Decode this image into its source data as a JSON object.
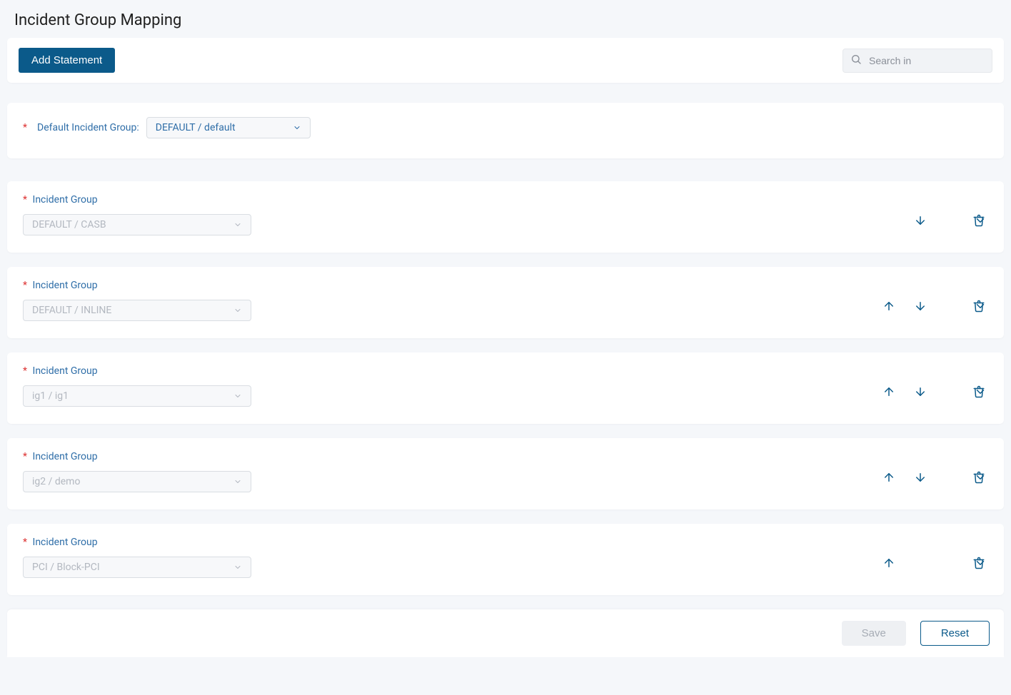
{
  "page": {
    "title": "Incident Group Mapping"
  },
  "toolbar": {
    "add_statement_label": "Add Statement",
    "search_placeholder": "Search in"
  },
  "default_group": {
    "label": "Default Incident Group",
    "value": "DEFAULT / default"
  },
  "rules": [
    {
      "label": "Incident Group",
      "value": "DEFAULT / CASB",
      "can_up": false,
      "can_down": true
    },
    {
      "label": "Incident Group",
      "value": "DEFAULT / INLINE",
      "can_up": true,
      "can_down": true
    },
    {
      "label": "Incident Group",
      "value": "ig1 / ig1",
      "can_up": true,
      "can_down": true
    },
    {
      "label": "Incident Group",
      "value": "ig2 / demo",
      "can_up": true,
      "can_down": true
    },
    {
      "label": "Incident Group",
      "value": "PCI / Block-PCI",
      "can_up": true,
      "can_down": false
    }
  ],
  "footer": {
    "save_label": "Save",
    "reset_label": "Reset"
  },
  "colors": {
    "primary": "#0b5a8a",
    "label_blue": "#2f6ea8",
    "required": "#d33"
  }
}
